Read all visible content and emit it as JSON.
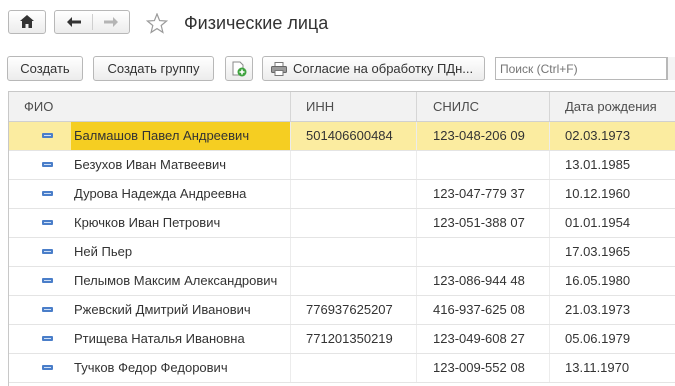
{
  "window": {
    "title": "Физические лица"
  },
  "nav": {
    "home_icon": "home-icon",
    "back_icon": "arrow-left-icon",
    "forward_icon": "arrow-right-icon",
    "favorite_icon": "star-icon"
  },
  "toolbar": {
    "create_label": "Создать",
    "create_group_label": "Создать группу",
    "add_icon": "add-document-icon",
    "consent_label": "Согласие на обработку ПДн...",
    "consent_icon": "printer-icon",
    "search_placeholder": "Поиск (Ctrl+F)"
  },
  "table": {
    "columns": [
      "ФИО",
      "ИНН",
      "СНИЛС",
      "Дата рождения"
    ],
    "rows": [
      {
        "name": "Балмашов Павел Андреевич",
        "inn": "501406600484",
        "snils": "123-048-206 09",
        "birth": "02.03.1973",
        "selected": true
      },
      {
        "name": "Безухов Иван Матвеевич",
        "inn": "",
        "snils": "",
        "birth": "13.01.1985",
        "selected": false
      },
      {
        "name": "Дурова Надежда Андреевна",
        "inn": "",
        "snils": "123-047-779 37",
        "birth": "10.12.1960",
        "selected": false
      },
      {
        "name": "Крючков Иван Петрович",
        "inn": "",
        "snils": "123-051-388 07",
        "birth": "01.01.1954",
        "selected": false
      },
      {
        "name": "Ней Пьер",
        "inn": "",
        "snils": "",
        "birth": "17.03.1965",
        "selected": false
      },
      {
        "name": "Пелымов Максим Александрович",
        "inn": "",
        "snils": "123-086-944 48",
        "birth": "16.05.1980",
        "selected": false
      },
      {
        "name": "Ржевский Дмитрий Иванович",
        "inn": "776937625207",
        "snils": "416-937-625 08",
        "birth": "21.03.1973",
        "selected": false
      },
      {
        "name": "Ртищева Наталья Ивановна",
        "inn": "771201350219",
        "snils": "123-049-608 27",
        "birth": "05.06.1979",
        "selected": false
      },
      {
        "name": "Тучков Федор Федорович",
        "inn": "",
        "snils": "123-009-552 08",
        "birth": "13.11.1970",
        "selected": false
      }
    ],
    "row_icon": "person-item-icon"
  },
  "colors": {
    "selected_row": "#fbeca0",
    "selected_cell": "#f5ce22",
    "row_icon": "#4a7ec9"
  }
}
